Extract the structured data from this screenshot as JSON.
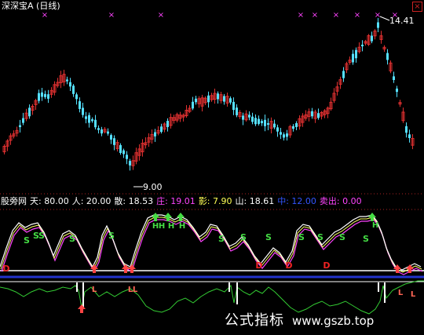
{
  "window": {
    "title": "深深宝A (日线)",
    "close_icon": "close-box-icon"
  },
  "price_panel": {
    "high_label": "14.41",
    "low_label": "9.00",
    "up_color": "#e03030",
    "down_color": "#55e0ff"
  },
  "indicator": {
    "name": "股旁网",
    "params": [
      {
        "key": "tian",
        "text": "天: 80.00",
        "color": "#ffffff"
      },
      {
        "key": "ren",
        "text": "人: 20.00",
        "color": "#ffffff"
      },
      {
        "key": "san",
        "text": "散: 18.53",
        "color": "#ffffff"
      },
      {
        "key": "zhuang",
        "text": "庄: 19.01",
        "color": "#ff44ff"
      },
      {
        "key": "ying",
        "text": "影: 7.90",
        "color": "#ffff55"
      },
      {
        "key": "shan",
        "text": "山: 18.61",
        "color": "#ffffff"
      },
      {
        "key": "zhong",
        "text": "中: 12.00",
        "color": "#3355ff"
      },
      {
        "key": "maichu",
        "text": "卖出: 0.00",
        "color": "#ff44ff"
      }
    ],
    "signal_labels": {
      "sell": "S",
      "hold": "H",
      "buy_arrow": "up-arrow-icon",
      "bottom": "D",
      "low": "L"
    }
  },
  "watermark": {
    "brand": "公式指标",
    "site": "www.gszb.top"
  }
}
